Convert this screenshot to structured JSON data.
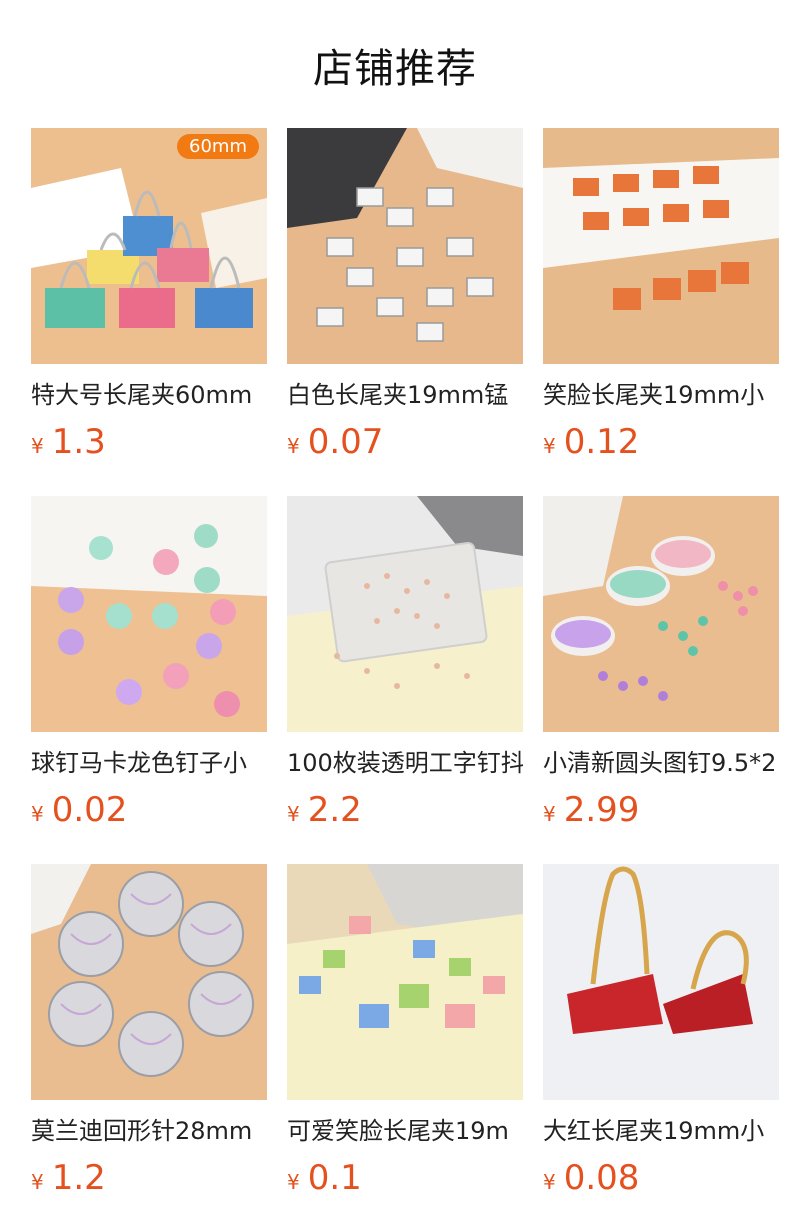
{
  "header": {
    "title": "店铺推荐"
  },
  "products": [
    {
      "name": "特大号长尾夹60mm",
      "currency": "¥",
      "price": "1.3",
      "badge": "60mm"
    },
    {
      "name": "白色长尾夹19mm锰",
      "currency": "¥",
      "price": "0.07"
    },
    {
      "name": "笑脸长尾夹19mm小",
      "currency": "¥",
      "price": "0.12"
    },
    {
      "name": "球钉马卡龙色钉子小",
      "currency": "¥",
      "price": "0.02"
    },
    {
      "name": "100枚装透明工字钉抖",
      "currency": "¥",
      "price": "2.2"
    },
    {
      "name": "小清新圆头图钉9.5*2",
      "currency": "¥",
      "price": "2.99"
    },
    {
      "name": "莫兰迪回形针28mm",
      "currency": "¥",
      "price": "1.2"
    },
    {
      "name": "可爱笑脸长尾夹19m",
      "currency": "¥",
      "price": "0.1"
    },
    {
      "name": "大红长尾夹19mm小",
      "currency": "¥",
      "price": "0.08"
    }
  ]
}
